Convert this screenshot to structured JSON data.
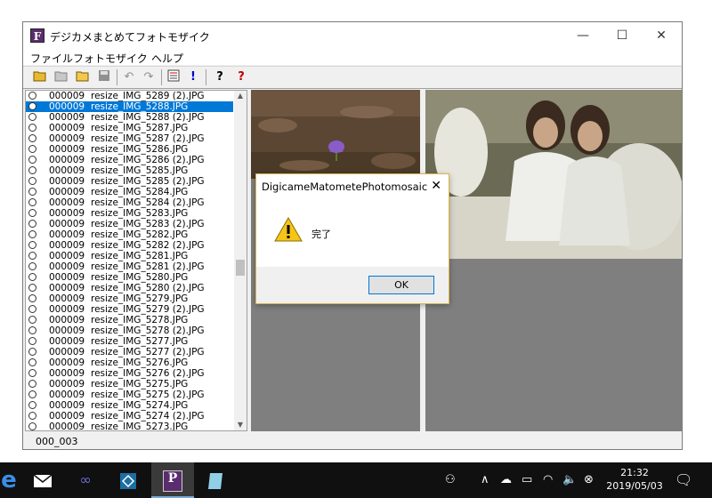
{
  "window": {
    "title": "デジカメまとめてフォトモザイク",
    "app_icon_letter": "F",
    "minimize_label": "—",
    "maximize_label": "☐",
    "close_label": "✕"
  },
  "menu": [
    "ファイル",
    "フォトモザイク",
    "ヘルプ"
  ],
  "file_list": [
    {
      "num": "000009",
      "name": "resize_IMG_5289 (2).JPG"
    },
    {
      "num": "000009",
      "name": "resize_IMG_5288.JPG",
      "selected": true
    },
    {
      "num": "000009",
      "name": "resize_IMG_5288 (2).JPG"
    },
    {
      "num": "000009",
      "name": "resize_IMG_5287.JPG"
    },
    {
      "num": "000009",
      "name": "resize_IMG_5287 (2).JPG"
    },
    {
      "num": "000009",
      "name": "resize_IMG_5286.JPG"
    },
    {
      "num": "000009",
      "name": "resize_IMG_5286 (2).JPG"
    },
    {
      "num": "000009",
      "name": "resize_IMG_5285.JPG"
    },
    {
      "num": "000009",
      "name": "resize_IMG_5285 (2).JPG"
    },
    {
      "num": "000009",
      "name": "resize_IMG_5284.JPG"
    },
    {
      "num": "000009",
      "name": "resize_IMG_5284 (2).JPG"
    },
    {
      "num": "000009",
      "name": "resize_IMG_5283.JPG"
    },
    {
      "num": "000009",
      "name": "resize_IMG_5283 (2).JPG"
    },
    {
      "num": "000009",
      "name": "resize_IMG_5282.JPG"
    },
    {
      "num": "000009",
      "name": "resize_IMG_5282 (2).JPG"
    },
    {
      "num": "000009",
      "name": "resize_IMG_5281.JPG"
    },
    {
      "num": "000009",
      "name": "resize_IMG_5281 (2).JPG"
    },
    {
      "num": "000009",
      "name": "resize_IMG_5280.JPG"
    },
    {
      "num": "000009",
      "name": "resize_IMG_5280 (2).JPG"
    },
    {
      "num": "000009",
      "name": "resize_IMG_5279.JPG"
    },
    {
      "num": "000009",
      "name": "resize_IMG_5279 (2).JPG"
    },
    {
      "num": "000009",
      "name": "resize_IMG_5278.JPG"
    },
    {
      "num": "000009",
      "name": "resize_IMG_5278 (2).JPG"
    },
    {
      "num": "000009",
      "name": "resize_IMG_5277.JPG"
    },
    {
      "num": "000009",
      "name": "resize_IMG_5277 (2).JPG"
    },
    {
      "num": "000009",
      "name": "resize_IMG_5276.JPG"
    },
    {
      "num": "000009",
      "name": "resize_IMG_5276 (2).JPG"
    },
    {
      "num": "000009",
      "name": "resize_IMG_5275.JPG"
    },
    {
      "num": "000009",
      "name": "resize_IMG_5275 (2).JPG"
    },
    {
      "num": "000009",
      "name": "resize_IMG_5274.JPG"
    },
    {
      "num": "000009",
      "name": "resize_IMG_5274 (2).JPG"
    },
    {
      "num": "000009",
      "name": "resize_IMG_5273.JPG"
    }
  ],
  "status": {
    "text": "000_003"
  },
  "dialog": {
    "title": "DigicameMatometePhotomosaic",
    "message": "完了",
    "ok_label": "OK"
  },
  "taskbar": {
    "time": "21:32",
    "date": "2019/05/03"
  },
  "colors": {
    "selection": "#0078d7",
    "panel_gray": "#7f7f7f",
    "taskbar": "#101010"
  }
}
